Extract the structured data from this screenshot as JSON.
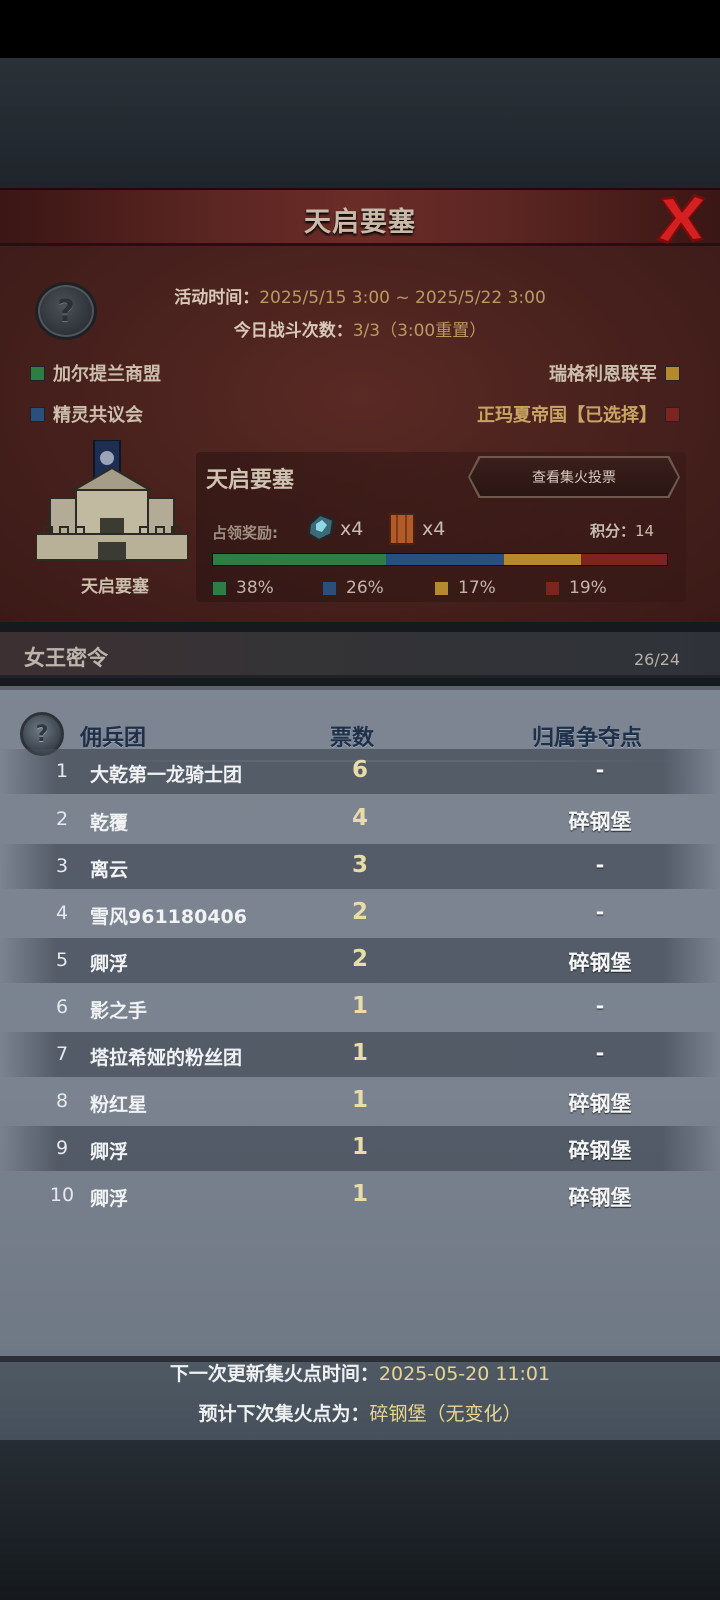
{
  "header": {
    "title": "天启要塞"
  },
  "event": {
    "time_label": "活动时间：",
    "time_value": "2025/5/15 3:00 ~ 2025/5/22 3:00",
    "battles_label": "今日战斗次数：",
    "battles_value": "3/3（3:00重置）"
  },
  "factions": [
    {
      "name": "加尔提兰商盟",
      "color": "#2f7d43"
    },
    {
      "name": "精灵共议会",
      "color": "#2a4f7a"
    },
    {
      "name": "瑞格利恩联军",
      "color": "#b48a2c"
    },
    {
      "name": "正玛夏帝国【已选择】",
      "color": "#7c2520"
    }
  ],
  "fortress": {
    "caption": "天启要塞",
    "title": "天启要塞",
    "vote_button": "查看集火投票",
    "reward_label": "占领奖励:",
    "reward_gem_qty": "x4",
    "reward_crate_qty": "x4",
    "score_label": "积分：",
    "score_value": "14",
    "shares": [
      {
        "label": "38%",
        "value": 38,
        "color": "#2f7d43"
      },
      {
        "label": "26%",
        "value": 26,
        "color": "#2a4f7a"
      },
      {
        "label": "17%",
        "value": 17,
        "color": "#b48a2c"
      },
      {
        "label": "19%",
        "value": 19,
        "color": "#7c2520"
      }
    ]
  },
  "queen": {
    "title": "女王密令",
    "count": "26/24"
  },
  "table": {
    "headers": {
      "legion": "佣兵团",
      "votes": "票数",
      "point": "归属争夺点"
    },
    "rows": [
      {
        "rank": "1",
        "name": "大乾第一龙骑士团",
        "votes": "6",
        "point": "-"
      },
      {
        "rank": "2",
        "name": "乾覆",
        "votes": "4",
        "point": "碎钢堡"
      },
      {
        "rank": "3",
        "name": "离云",
        "votes": "3",
        "point": "-"
      },
      {
        "rank": "4",
        "name": "雪风961180406",
        "votes": "2",
        "point": "-"
      },
      {
        "rank": "5",
        "name": "卿浮",
        "votes": "2",
        "point": "碎钢堡"
      },
      {
        "rank": "6",
        "name": "影之手",
        "votes": "1",
        "point": "-"
      },
      {
        "rank": "7",
        "name": "塔拉希娅的粉丝团",
        "votes": "1",
        "point": "-"
      },
      {
        "rank": "8",
        "name": "粉红星",
        "votes": "1",
        "point": "碎钢堡"
      },
      {
        "rank": "9",
        "name": "卿浮",
        "votes": "1",
        "point": "碎钢堡"
      },
      {
        "rank": "10",
        "name": "卿浮",
        "votes": "1",
        "point": "碎钢堡"
      }
    ]
  },
  "footer": {
    "next_update_label": "下一次更新集火点时间：",
    "next_update_value": "2025-05-20 11:01",
    "forecast_label": "预计下次集火点为：",
    "forecast_value": "碎钢堡（无变化）"
  }
}
